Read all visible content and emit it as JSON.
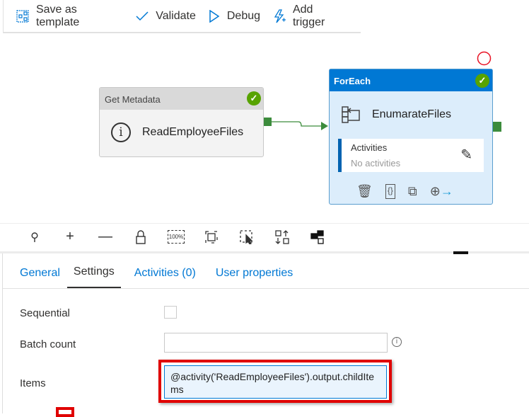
{
  "toolbar": {
    "save_template": "Save as template",
    "validate": "Validate",
    "debug": "Debug",
    "add_trigger": "Add trigger"
  },
  "nodes": {
    "get_metadata": {
      "type": "Get Metadata",
      "name": "ReadEmployeeFiles",
      "status": "succeeded"
    },
    "foreach": {
      "type": "ForEach",
      "name": "EnumarateFiles",
      "activities_label": "Activities",
      "activities_value": "No activities",
      "status": "succeeded"
    }
  },
  "canvas_toolbar": {
    "zoom_label": "100%"
  },
  "tabs": [
    {
      "label": "General"
    },
    {
      "label": "Settings"
    },
    {
      "label": "Activities (0)"
    },
    {
      "label": "User properties"
    }
  ],
  "settings": {
    "sequential_label": "Sequential",
    "sequential_checked": false,
    "batch_count_label": "Batch count",
    "batch_count_value": "",
    "items_label": "Items",
    "items_value": "@activity('ReadEmployeeFiles').output.childItems"
  },
  "colors": {
    "accent": "#0078d4",
    "success": "#57a300",
    "highlight": "#e00000"
  }
}
